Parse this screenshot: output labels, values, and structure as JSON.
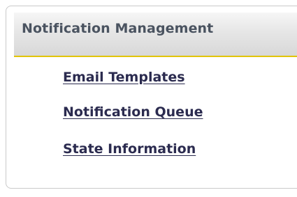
{
  "panel": {
    "title": "Notification Management",
    "accent_color": "#e2c400",
    "links": [
      {
        "label": "Email Templates"
      },
      {
        "label": "Notification Queue"
      },
      {
        "label": "State Information"
      }
    ]
  }
}
